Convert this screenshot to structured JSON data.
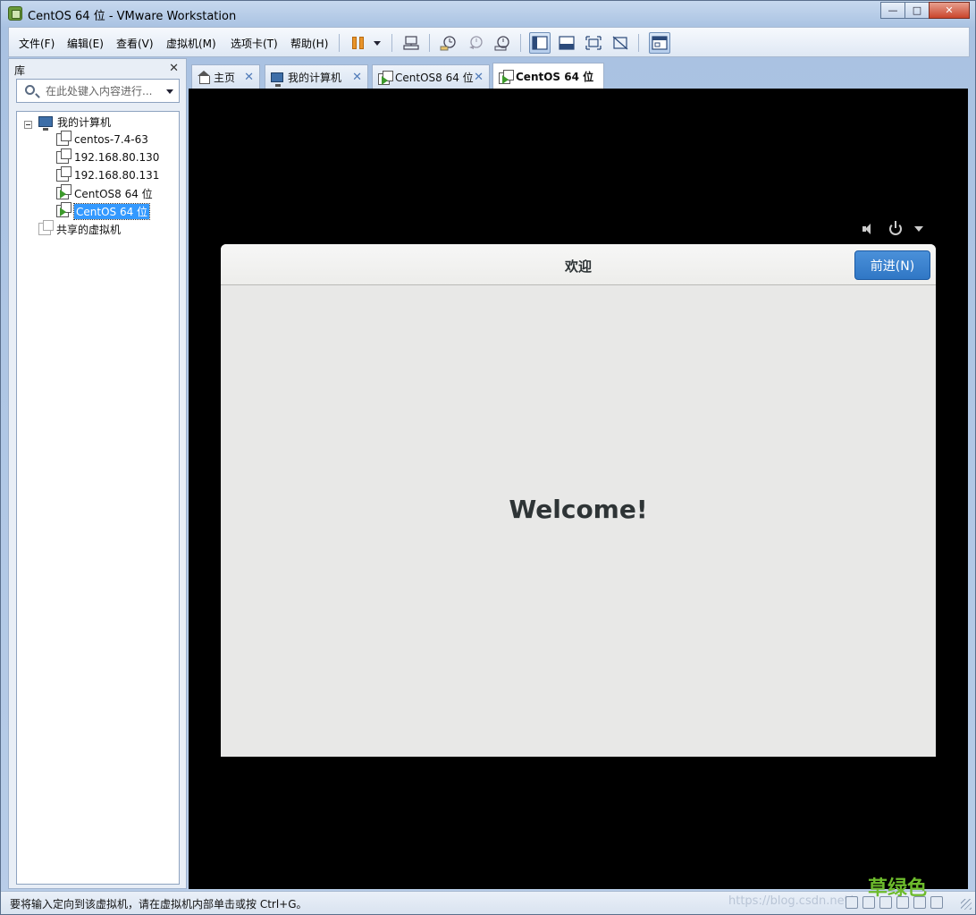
{
  "window": {
    "title": "CentOS 64 位 - VMware Workstation",
    "minimize": "—",
    "maximize": "□",
    "close": "✕"
  },
  "menu": {
    "items": [
      "文件(F)",
      "编辑(E)",
      "查看(V)",
      "虚拟机(M)",
      "选项卡(T)",
      "帮助(H)"
    ]
  },
  "toolbar": {
    "icons": [
      "pause-icon",
      "send-ctrl-alt-del-icon",
      "snapshot-icon",
      "revert-snapshot-icon",
      "snapshot-manager-icon",
      "library-view-icon",
      "console-view-icon",
      "fullscreen-icon",
      "unity-icon",
      "thumbnail-icon"
    ]
  },
  "sidebar": {
    "title": "库",
    "close": "✕",
    "search_placeholder": "在此处键入内容进行...",
    "tree": {
      "root": "我的计算机",
      "vms": [
        "centos-7.4-63",
        "192.168.80.130",
        "192.168.80.131",
        "CentOS8 64 位",
        "CentOS 64 位"
      ],
      "selected_index": 4,
      "shared": "共享的虚拟机"
    }
  },
  "tabs": [
    {
      "label": "主页",
      "icon": "home-icon",
      "active": false
    },
    {
      "label": "我的计算机",
      "icon": "computer-icon",
      "active": false
    },
    {
      "label": "CentOS8 64 位",
      "icon": "vm-icon",
      "active": false
    },
    {
      "label": "CentOS 64 位",
      "icon": "vm-icon",
      "active": true
    }
  ],
  "tab_close": "✕",
  "guest": {
    "dialog_title": "欢迎",
    "next_button": "前进(N)",
    "welcome": "Welcome!"
  },
  "status": {
    "text": "要将输入定向到该虚拟机，请在虚拟机内部单击或按 Ctrl+G。",
    "watermark": "https://blog.csdn.net/",
    "brand": "草绿色"
  },
  "colors": {
    "accent": "#3077c5",
    "selection": "#3399ff",
    "vm_background": "#000000"
  }
}
